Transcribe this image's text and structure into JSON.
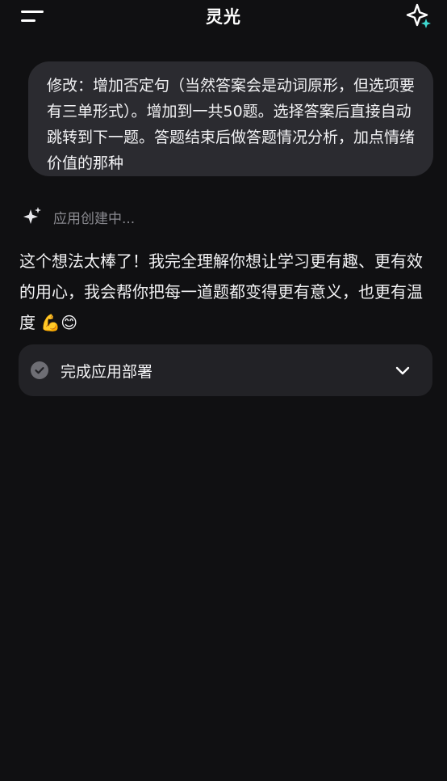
{
  "header": {
    "title": "灵光"
  },
  "user_message": {
    "text": "修改：增加否定句（当然答案会是动词原形，但选项要有三单形式）。增加到一共50题。选择答案后直接自动跳转到下一题。答题结束后做答题情况分析，加点情绪价值的那种"
  },
  "status": {
    "text": "应用创建中..."
  },
  "assistant_message": {
    "text": "这个想法太棒了！我完全理解你想让学习更有趣、更有效的用心，我会帮你把每一道题都变得更有意义，也更有温度 💪😊"
  },
  "deploy_step": {
    "label": "完成应用部署",
    "state": "completed"
  },
  "icons": {
    "menu": "menu-icon",
    "sparkle": "sparkle-icon",
    "loading": "sparkle-loading-icon",
    "check": "check-circle-icon",
    "chevron": "chevron-down-icon"
  },
  "colors": {
    "background": "#101012",
    "bubble": "#2b2b30",
    "card": "#222226",
    "accent": "#3fd9d0",
    "muted": "#8a8a90"
  }
}
